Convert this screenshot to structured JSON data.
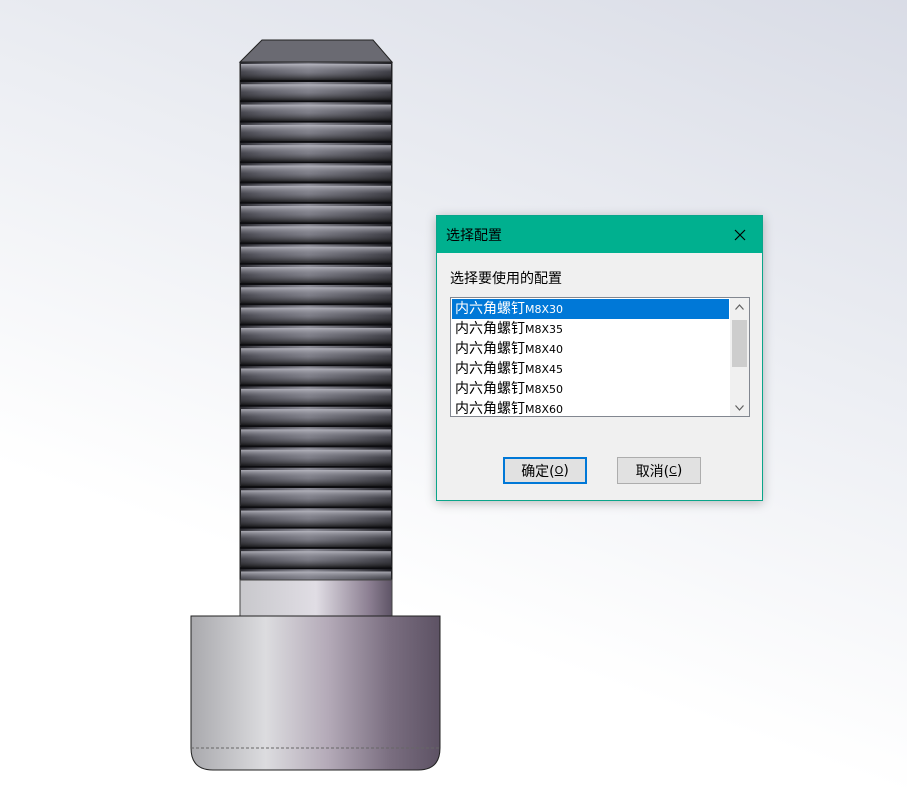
{
  "dialog": {
    "title": "选择配置",
    "prompt": "选择要使用的配置",
    "items": [
      {
        "name": "内六角螺钉",
        "code": "M8X30",
        "selected": true
      },
      {
        "name": "内六角螺钉",
        "code": "M8X35",
        "selected": false
      },
      {
        "name": "内六角螺钉",
        "code": "M8X40",
        "selected": false
      },
      {
        "name": "内六角螺钉",
        "code": "M8X45",
        "selected": false
      },
      {
        "name": "内六角螺钉",
        "code": "M8X50",
        "selected": false
      },
      {
        "name": "内六角螺钉",
        "code": "M8X60",
        "selected": false
      }
    ],
    "ok_label": "确定(",
    "ok_key": "O",
    "ok_tail": ")",
    "cancel_label": "取消(",
    "cancel_key": "C",
    "cancel_tail": ")"
  },
  "colors": {
    "titlebar": "#00b08f",
    "selection": "#0078d7"
  },
  "icons": {
    "close": "close-icon",
    "scroll_up": "chevron-up-icon",
    "scroll_down": "chevron-down-icon"
  }
}
